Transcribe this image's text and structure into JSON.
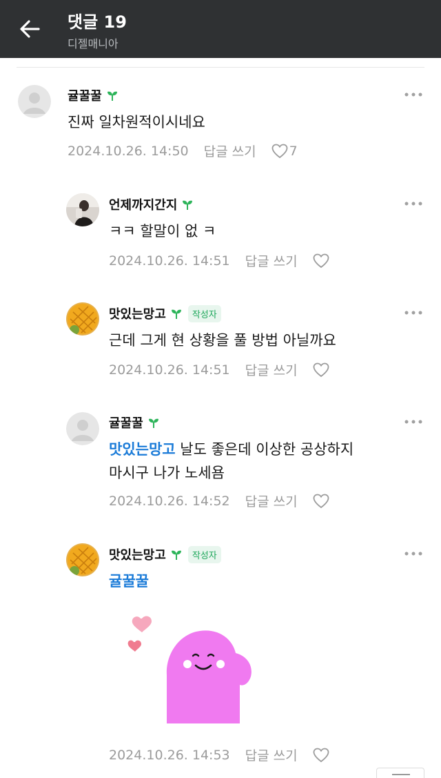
{
  "header": {
    "title": "댓글 19",
    "subtitle": "디젤매니아"
  },
  "comments": [
    {
      "nickname": "귤꿀꿀",
      "author_badge": "",
      "mention": "",
      "text": "진짜 일차원적이시네요",
      "date": "2024.10.26. 14:50",
      "reply_label": "답글 쓰기",
      "likes": "7",
      "avatar": "default-avatar"
    },
    {
      "nickname": "언제까지간지",
      "author_badge": "",
      "mention": "",
      "text": "ㅋㅋ 할말이 없 ㅋ",
      "date": "2024.10.26. 14:51",
      "reply_label": "답글 쓰기",
      "likes": "",
      "avatar": "photo-avatar"
    },
    {
      "nickname": "맛있는망고",
      "author_badge": "작성자",
      "mention": "",
      "text": "근데 그게 현 상황을 풀 방법 아닐까요",
      "date": "2024.10.26. 14:51",
      "reply_label": "답글 쓰기",
      "likes": "",
      "avatar": "mango-avatar"
    },
    {
      "nickname": "귤꿀꿀",
      "author_badge": "",
      "mention": "맛있는망고",
      "text": " 날도 좋은데 이상한 공상하지\n마시구 나가 노세욤",
      "date": "2024.10.26. 14:52",
      "reply_label": "답글 쓰기",
      "likes": "",
      "avatar": "default-avatar"
    },
    {
      "nickname": "맛있는망고",
      "author_badge": "작성자",
      "mention": "귤꿀꿀",
      "text": "",
      "date": "2024.10.26. 14:53",
      "reply_label": "답글 쓰기",
      "likes": "",
      "avatar": "mango-avatar",
      "sticker": "pink-smiling-blob-with-hearts"
    }
  ],
  "colors": {
    "topbar": "#2f3133",
    "mention": "#1a7bd8",
    "sprout": "#2db45a",
    "sticker": "#f07af0"
  }
}
